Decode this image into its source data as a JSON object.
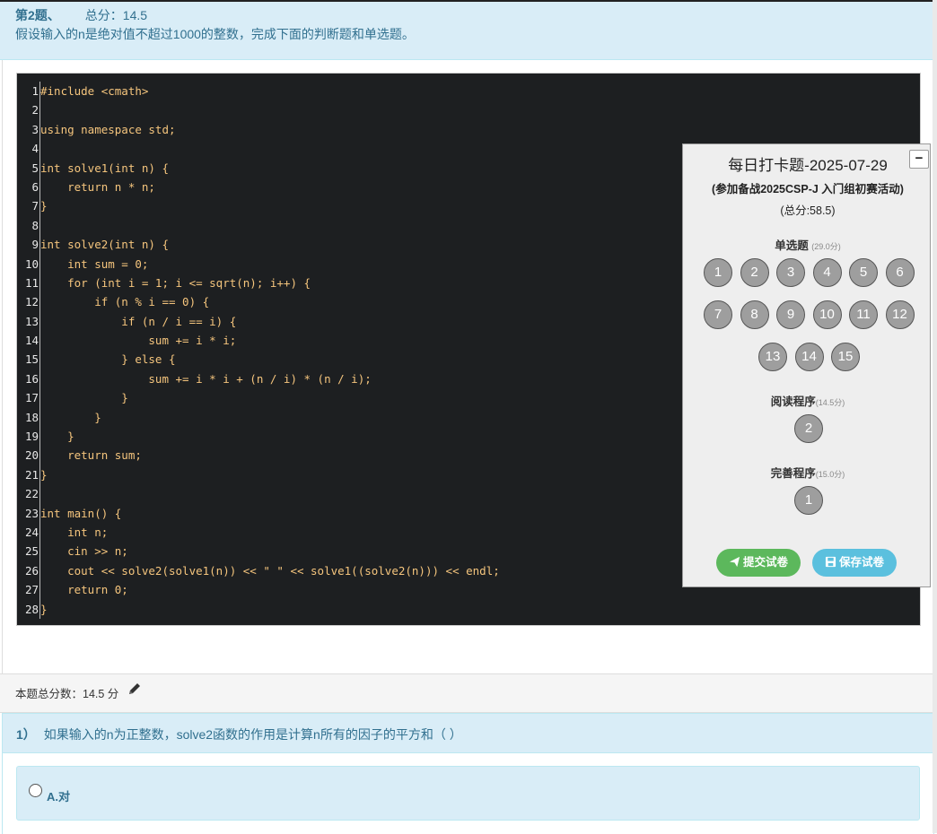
{
  "question": {
    "number": "第2题、",
    "score_label": "总分：14.5",
    "description": "假设输入的n是绝对值不超过1000的整数，完成下面的判断题和单选题。"
  },
  "code_lines": [
    "#include <cmath>",
    "",
    "using namespace std;",
    "",
    "int solve1(int n) {",
    "    return n * n;",
    "}",
    "",
    "int solve2(int n) {",
    "    int sum = 0;",
    "    for (int i = 1; i <= sqrt(n); i++) {",
    "        if (n % i == 0) {",
    "            if (n / i == i) {",
    "                sum += i * i;",
    "            } else {",
    "                sum += i * i + (n / i) * (n / i);",
    "            }",
    "        }",
    "    }",
    "    return sum;",
    "}",
    "",
    "int main() {",
    "    int n;",
    "    cin >> n;",
    "    cout << solve2(solve1(n)) << \" \" << solve1((solve2(n))) << endl;",
    "    return 0;",
    "}"
  ],
  "score_bar": {
    "text": "本题总分数：14.5 分",
    "icon": "pencil-icon"
  },
  "subquestion": {
    "number": "1）",
    "text": "如果输入的n为正整数，solve2函数的作用是计算n所有的因子的平方和（ ）",
    "option_a": "A.对"
  },
  "panel": {
    "minimize": "−",
    "title": "每日打卡题-2025-07-29",
    "subtitle": "(参加备战2025CSP-J 入门组初赛活动)",
    "total": "(总分:58.5)",
    "single_choice": {
      "label": "单选题",
      "points": "(29.0分)",
      "items": [
        "1",
        "2",
        "3",
        "4",
        "5",
        "6",
        "7",
        "8",
        "9",
        "10",
        "11",
        "12",
        "13",
        "14",
        "15"
      ]
    },
    "reading": {
      "label": "阅读程序",
      "points": "(14.5分)",
      "items": [
        "2"
      ]
    },
    "completion": {
      "label": "完善程序",
      "points": "(15.0分)",
      "items": [
        "1"
      ]
    },
    "submit_label": "提交试卷",
    "save_label": "保存试卷",
    "colors": {
      "submit": "#5cb85c",
      "save": "#5bc0de",
      "circle": "#9e9e9e"
    }
  }
}
